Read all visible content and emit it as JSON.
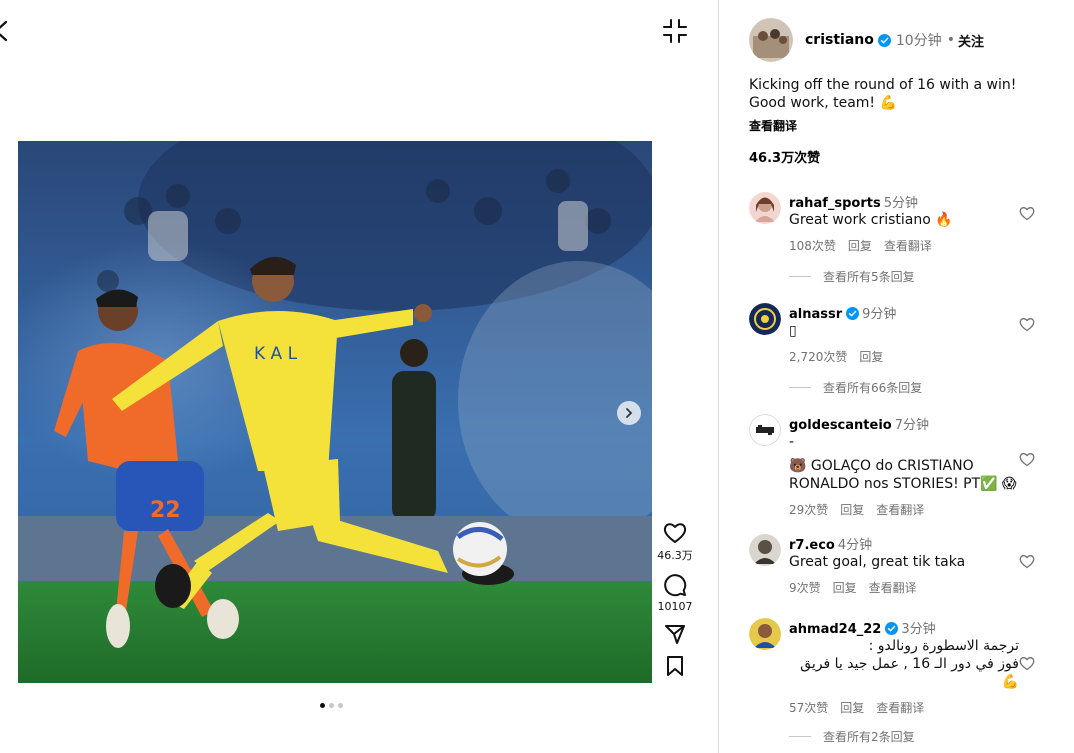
{
  "post": {
    "author": "cristiano",
    "time": "10分钟",
    "separator": "•",
    "follow_label": "关注",
    "caption": "Kicking off the round of 16 with a win! Good work, team! 💪",
    "translate_label": "查看翻译",
    "likes": "46.3万次赞",
    "image_alt": "Football player in yellow Al Nassr kit striking the ball"
  },
  "actions": {
    "like_count": "46.3万",
    "comment_count": "10107"
  },
  "carousel": {
    "current": 1,
    "total": 3
  },
  "comments": [
    {
      "user": "rahaf_sports",
      "verified": false,
      "time": "5分钟",
      "text": "Great work cristiano 🔥",
      "likes": "108次赞",
      "reply": "回复",
      "translate": "查看翻译",
      "view_replies": "查看所有5条回复"
    },
    {
      "user": "alnassr",
      "verified": true,
      "time": "9分钟",
      "text": "▯",
      "likes": "2,720次赞",
      "reply": "回复",
      "view_replies": "查看所有66条回复"
    },
    {
      "user": "goldescanteio",
      "verified": false,
      "time": "7分钟",
      "text_line1": "-",
      "text_line2": "🐻 GOLAÇO do CRISTIANO RONALDO nos STORIES! PT✅ 😱",
      "likes": "29次赞",
      "reply": "回复",
      "translate": "查看翻译"
    },
    {
      "user": "r7.eco",
      "verified": false,
      "time": "4分钟",
      "text": "Great goal, great tik taka",
      "likes": "9次赞",
      "reply": "回复",
      "translate": "查看翻译"
    },
    {
      "user": "ahmad24_22",
      "verified": true,
      "time": "3分钟",
      "text_line1": "ترجمة الاسطورة رونالدو :",
      "text_line2": "فوز في دور الـ 16 , عمل جيد يا فريق",
      "text_line3": "💪",
      "likes": "57次赞",
      "reply": "回复",
      "translate": "查看翻译",
      "view_replies": "查看所有2条回复"
    }
  ],
  "colors": {
    "verified_blue": "#0095f6",
    "secondary_text": "#737373",
    "divider": "#dbdbdb"
  }
}
